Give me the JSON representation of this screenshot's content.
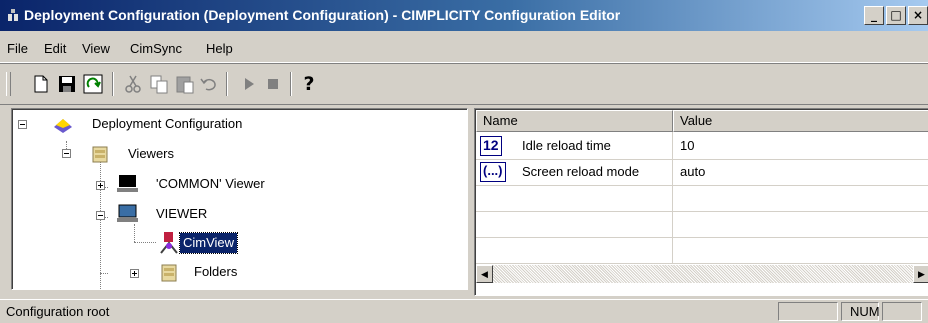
{
  "window": {
    "title": "Deployment Configuration (Deployment Configuration) - CIMPLICITY Configuration Editor",
    "minimize": "_",
    "maximize": "□",
    "close": "×"
  },
  "menubar": {
    "items": [
      "File",
      "Edit",
      "View",
      "CimSync",
      "Help"
    ]
  },
  "toolbar": {
    "buttons": [
      "new-icon",
      "save-icon",
      "refresh-icon",
      "cut-icon",
      "copy-icon",
      "paste-icon",
      "undo-icon",
      "run-icon",
      "stop-icon",
      "help-icon"
    ],
    "help_glyph": "?"
  },
  "tree": {
    "root": "Deployment Configuration",
    "viewers": "Viewers",
    "common_viewer": "'COMMON' Viewer",
    "viewer": "VIEWER",
    "cimview": "CimView",
    "folders": "Folders"
  },
  "properties": {
    "columns": [
      "Name",
      "Value"
    ],
    "rows": [
      {
        "badge": "12",
        "name": "Idle reload time",
        "value": "10"
      },
      {
        "badge": "(...)",
        "name": "Screen reload mode",
        "value": "auto"
      }
    ],
    "scroll_left": "◀",
    "scroll_right": "▶"
  },
  "statusbar": {
    "text": "Configuration root",
    "num": "NUM"
  },
  "colors": {
    "titlebar_start": "#0a246a",
    "selection": "#0a246a",
    "badge": "#000080"
  }
}
